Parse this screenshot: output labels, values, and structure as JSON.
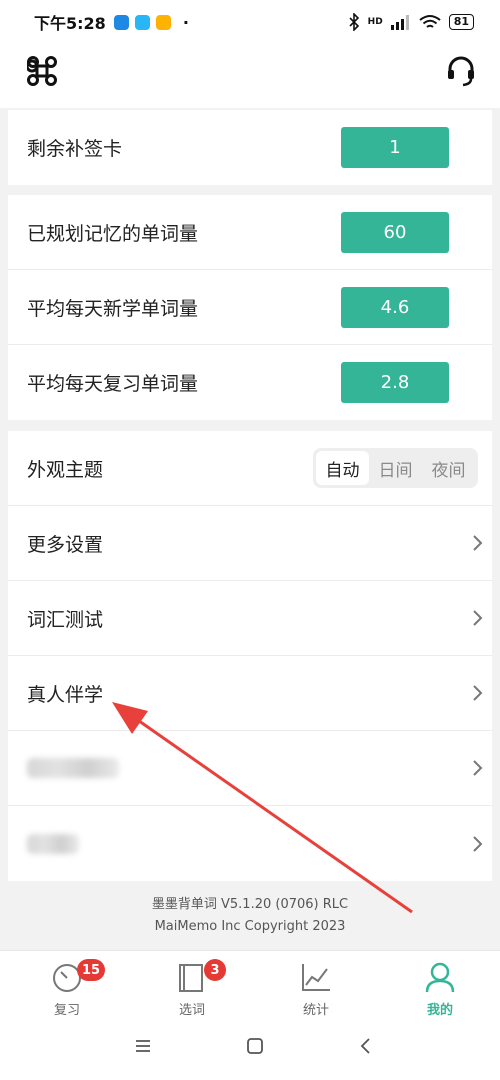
{
  "status_bar": {
    "time": "下午5:28",
    "network": "HD",
    "battery": "81"
  },
  "rows": {
    "makeup_cards": {
      "label": "剩余补签卡",
      "value": "1"
    },
    "planned_words": {
      "label": "已规划记忆的单词量",
      "value": "60"
    },
    "avg_new_words": {
      "label": "平均每天新学单词量",
      "value": "4.6"
    },
    "avg_review_words": {
      "label": "平均每天复习单词量",
      "value": "2.8"
    }
  },
  "theme": {
    "label": "外观主题",
    "options": [
      "自动",
      "日间",
      "夜间"
    ],
    "selected": "自动"
  },
  "menu": {
    "more_settings": "更多设置",
    "vocab_test": "词汇测试",
    "companion_study": "真人伴学"
  },
  "footer": {
    "version": "墨墨背单词 V5.1.20 (0706) RLC",
    "copyright": "MaiMemo Inc Copyright 2023"
  },
  "tabs": [
    {
      "label": "复习",
      "badge": "15"
    },
    {
      "label": "选词",
      "badge": "3"
    },
    {
      "label": "统计"
    },
    {
      "label": "我的"
    }
  ],
  "colors": {
    "accent": "#35b597",
    "badge_red": "#e53935",
    "annotation_arrow": "#e8403a"
  },
  "icons": {
    "top_left": "command-icon",
    "top_right": "headset-icon",
    "chevron": "chevron-right-icon"
  }
}
